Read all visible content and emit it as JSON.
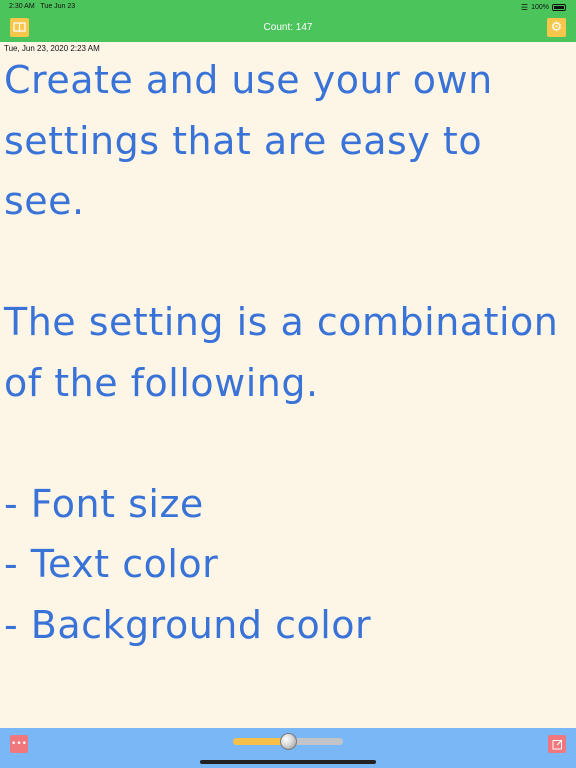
{
  "status_bar": {
    "time": "2:30 AM",
    "date": "Tue Jun 23",
    "battery": "100%",
    "wifi_icon": "wifi-icon"
  },
  "nav": {
    "title": "Count: 147",
    "left_icon": "book-icon",
    "right_icon": "gear-icon",
    "accent": "#4cc45c",
    "button_color": "#f7c64a"
  },
  "datetime": "Tue, Jun 23, 2020 2:23 AM",
  "content": {
    "text_color": "#3a73d8",
    "background": "#fdf6e6",
    "lines": [
      "Create and use your own",
      "settings that are easy to",
      "see.",
      "",
      "The setting is a combination",
      "of the following.",
      "",
      "- Font size",
      "- Text color",
      "- Background color"
    ]
  },
  "bottom_bar": {
    "color": "#7ab7f7",
    "left_icon": "more-icon",
    "right_icon": "edit-icon",
    "slider_value": 0.5
  }
}
